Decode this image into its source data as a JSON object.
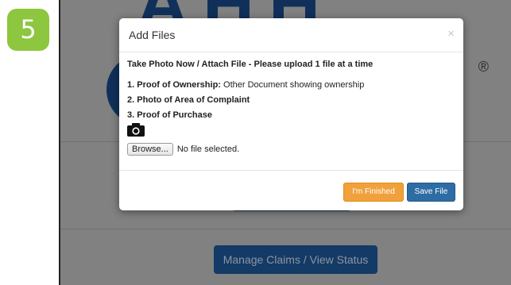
{
  "step_number": "5",
  "background": {
    "manage_button_label": "Manage Claims / View Status",
    "registered_mark": "®"
  },
  "modal": {
    "title": "Add Files",
    "close_symbol": "×",
    "instruction": "Take Photo Now / Attach File - Please upload 1 file at a time",
    "items": [
      {
        "label": "1. Proof of Ownership:",
        "detail": " Other Document showing ownership"
      },
      {
        "label": "2. Photo of Area of Complaint",
        "detail": ""
      },
      {
        "label": "3. Proof of Purchase",
        "detail": ""
      }
    ],
    "camera_icon": "camera-icon",
    "browse_label": "Browse...",
    "file_status": "No file selected.",
    "finish_label": "I'm Finished",
    "save_label": "Save File"
  },
  "colors": {
    "step_badge": "#8dc63f",
    "finish_button": "#f0a13c",
    "save_button": "#2e6da4",
    "brand_navy": "#10305a"
  }
}
